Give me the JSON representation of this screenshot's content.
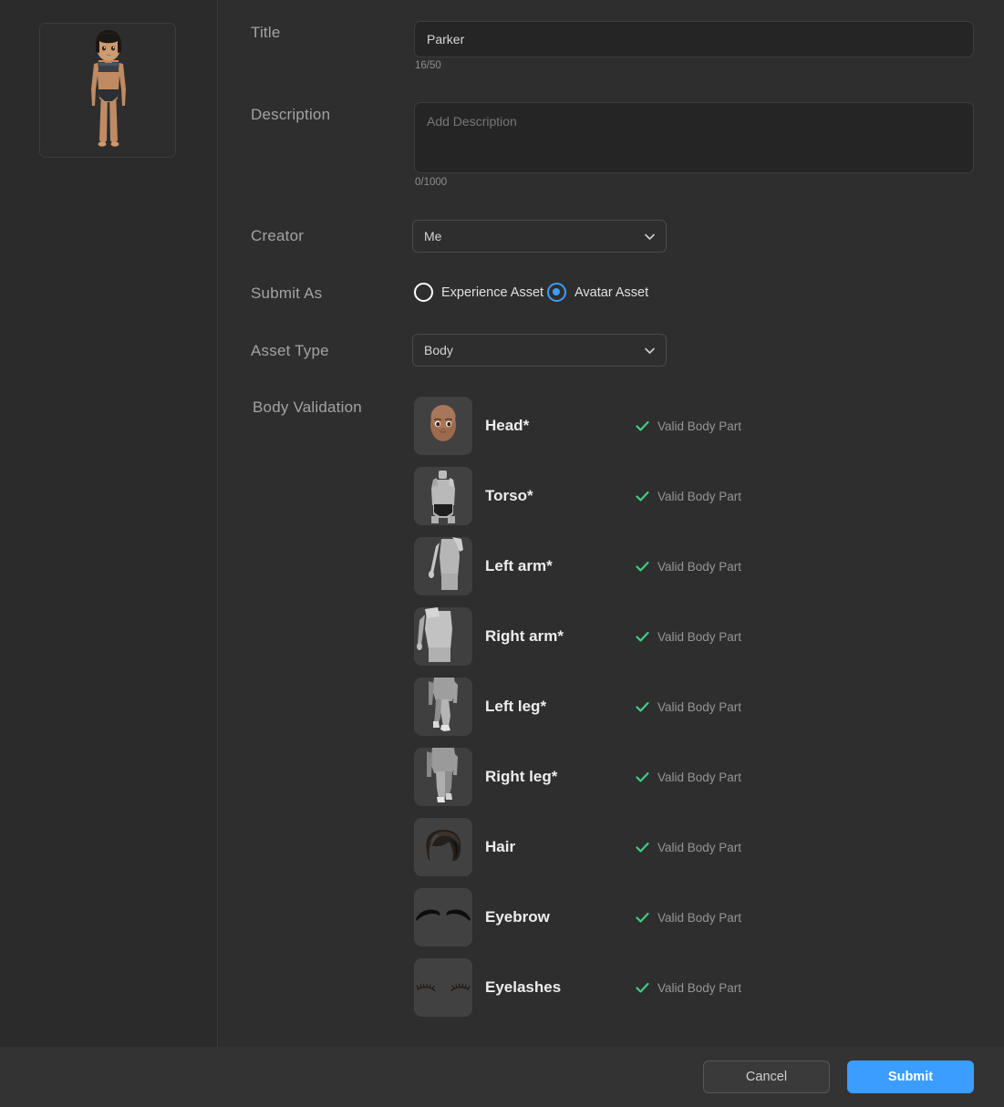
{
  "theme": {
    "page_bg": "#2b2b2b",
    "panel_bg": "#2e2e2e",
    "accent": "#3b9dff",
    "valid_green": "#3ecf82",
    "label_gray": "#a3a3a3"
  },
  "preview": {
    "name": "avatar-preview",
    "alt": "Avatar full body preview"
  },
  "form": {
    "title": {
      "label": "Title",
      "value": "Parker",
      "placeholder": "",
      "counter": "16/50"
    },
    "description": {
      "label": "Description",
      "value": "",
      "placeholder": "Add Description",
      "counter": "0/1000"
    },
    "creator": {
      "label": "Creator",
      "value": "Me",
      "options": [
        "Me"
      ]
    },
    "submit_as": {
      "label": "Submit As",
      "options": [
        {
          "label": "Experience Asset",
          "selected": false
        },
        {
          "label": "Avatar Asset",
          "selected": true
        }
      ]
    },
    "asset_type": {
      "label": "Asset Type",
      "value": "Body",
      "options": [
        "Body"
      ]
    },
    "body_validation": {
      "label": "Body Validation",
      "status_label": "Valid Body Part",
      "rows": [
        {
          "name": "Head*",
          "thumb": "head-thumbnail",
          "status": "Valid Body Part"
        },
        {
          "name": "Torso*",
          "thumb": "torso-thumbnail",
          "status": "Valid Body Part"
        },
        {
          "name": "Left arm*",
          "thumb": "left-arm-thumbnail",
          "status": "Valid Body Part"
        },
        {
          "name": "Right arm*",
          "thumb": "right-arm-thumbnail",
          "status": "Valid Body Part"
        },
        {
          "name": "Left leg*",
          "thumb": "left-leg-thumbnail",
          "status": "Valid Body Part"
        },
        {
          "name": "Right leg*",
          "thumb": "right-leg-thumbnail",
          "status": "Valid Body Part"
        },
        {
          "name": "Hair",
          "thumb": "hair-thumbnail",
          "status": "Valid Body Part"
        },
        {
          "name": "Eyebrow",
          "thumb": "eyebrow-thumbnail",
          "status": "Valid Body Part"
        },
        {
          "name": "Eyelashes",
          "thumb": "eyelashes-thumbnail",
          "status": "Valid Body Part"
        }
      ]
    }
  },
  "footer": {
    "cancel_label": "Cancel",
    "submit_label": "Submit"
  }
}
